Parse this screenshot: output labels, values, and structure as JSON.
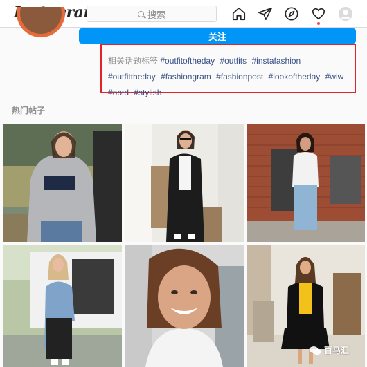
{
  "header": {
    "logo": "Instagram",
    "search_placeholder": "搜索",
    "icons": [
      "home-icon",
      "direct-icon",
      "explore-icon",
      "activity-heart-icon",
      "profile-avatar-icon"
    ]
  },
  "profile": {
    "follow_label": "关注"
  },
  "hashtags": {
    "label": "相关话题标签",
    "tags": [
      "#outfitoftheday",
      "#outfits",
      "#instafashion",
      "#outfittheday",
      "#fashiongram",
      "#fashionpost",
      "#lookoftheday",
      "#wiw",
      "#ootd",
      "#stylish"
    ]
  },
  "posts": {
    "title": "热门帖子"
  },
  "watermark": {
    "text": "百马汇"
  },
  "colors": {
    "accent": "#0095f6",
    "highlight_border": "#e0242b",
    "tag_link": "#385185"
  }
}
